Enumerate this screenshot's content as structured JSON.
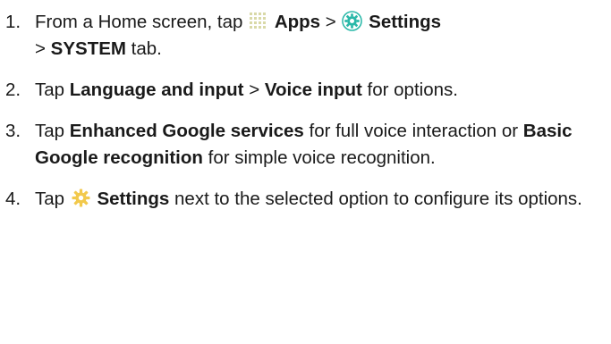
{
  "steps": [
    {
      "number": "1.",
      "parts": {
        "t1": "From a Home screen, tap ",
        "apps": "Apps",
        "t2": " > ",
        "settings": "Settings",
        "t3": " > ",
        "system": "SYSTEM",
        "t4": " tab."
      },
      "icons": [
        "apps-grid-icon",
        "settings-gear-icon"
      ]
    },
    {
      "number": "2.",
      "parts": {
        "t1": "Tap ",
        "language": "Language and input",
        "t2": " > ",
        "voice": "Voice input",
        "t3": " for options."
      }
    },
    {
      "number": "3.",
      "parts": {
        "t1": "Tap ",
        "enhanced": "Enhanced Google services",
        "t2": " for full voice interaction or ",
        "basic": "Basic Google recognition",
        "t3": " for simple voice recognition."
      }
    },
    {
      "number": "4.",
      "parts": {
        "t1": "Tap ",
        "settings": "Settings",
        "t2": " next to the selected option to configure its options."
      },
      "icons": [
        "gear-icon"
      ]
    }
  ],
  "colors": {
    "text": "#1a1a1a",
    "apps_icon": "#d9d9a8",
    "settings_icon": "#29b8a8",
    "gear_icon": "#f2c94c"
  }
}
